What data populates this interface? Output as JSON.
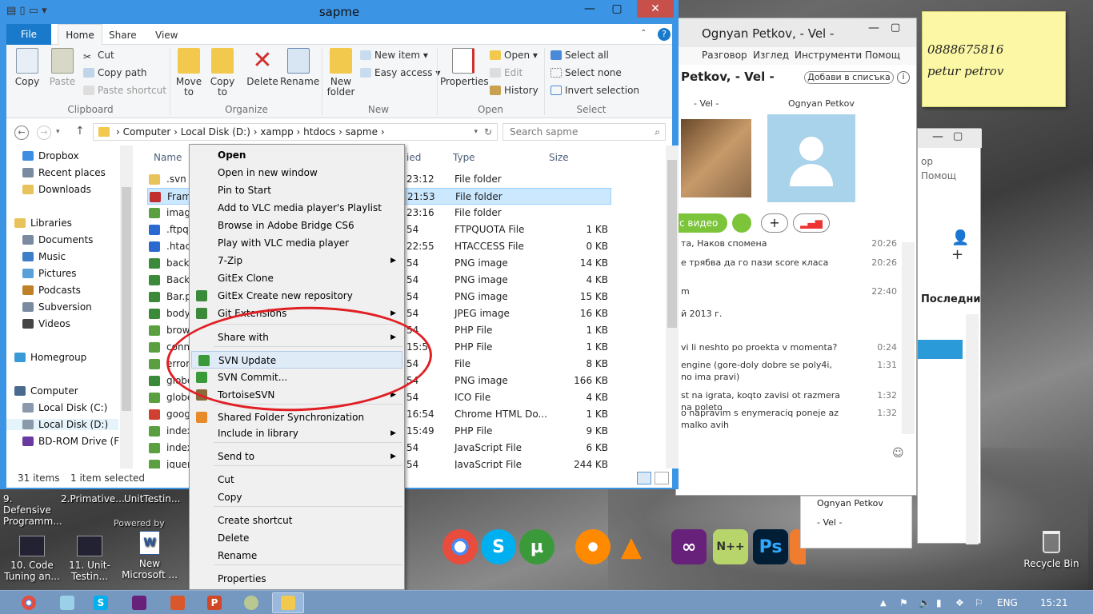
{
  "desktop": {
    "top_labels": [
      "9. Defensive Programm...",
      "2.Primative...",
      "UnitTestin..."
    ],
    "icons": [
      {
        "label": "10. Code Tuning an..."
      },
      {
        "label": "11. Unit-Testin..."
      },
      {
        "label": "New Microsoft ..."
      }
    ],
    "recycle_bin": "Recycle Bin",
    "powered_by": "Powered by"
  },
  "sticky_note": {
    "line1": "0888675816",
    "line2": "petur petrov"
  },
  "explorer": {
    "title": "sapme",
    "tabs": {
      "file": "File",
      "home": "Home",
      "share": "Share",
      "view": "View"
    },
    "ribbon": {
      "copy": "Copy",
      "paste": "Paste",
      "cut": "Cut",
      "copy_path": "Copy path",
      "paste_shortcut": "Paste shortcut",
      "clipboard": "Clipboard",
      "move_to": "Move to",
      "copy_to": "Copy to",
      "delete": "Delete",
      "rename": "Rename",
      "organize": "Organize",
      "new_folder": "New folder",
      "new_item": "New item",
      "easy_access": "Easy access",
      "new": "New",
      "properties": "Properties",
      "open": "Open",
      "edit": "Edit",
      "history": "History",
      "open_group": "Open",
      "select_all": "Select all",
      "select_none": "Select none",
      "invert_selection": "Invert selection",
      "select": "Select"
    },
    "breadcrumb": [
      "Computer",
      "Local Disk (D:)",
      "xampp",
      "htdocs",
      "sapme"
    ],
    "search_placeholder": "Search sapme",
    "nav": [
      {
        "label": "Dropbox",
        "color": "#3d8ee0"
      },
      {
        "label": "Recent places",
        "color": "#7a8aa0"
      },
      {
        "label": "Downloads",
        "color": "#e8c25a"
      },
      {
        "label": "Libraries",
        "color": "#e8c25a"
      },
      {
        "label": "Documents",
        "color": "#7a8aa0"
      },
      {
        "label": "Music",
        "color": "#3d7ec9"
      },
      {
        "label": "Pictures",
        "color": "#5aa0d8"
      },
      {
        "label": "Podcasts",
        "color": "#c0802a"
      },
      {
        "label": "Subversion",
        "color": "#7a8aa0"
      },
      {
        "label": "Videos",
        "color": "#444"
      },
      {
        "label": "Homegroup",
        "color": "#3a9ad8"
      },
      {
        "label": "Computer",
        "color": "#4a6a90"
      },
      {
        "label": "Local Disk (C:)",
        "color": "#8a9aaa"
      },
      {
        "label": "Local Disk (D:)",
        "color": "#8a9aaa"
      },
      {
        "label": "BD-ROM Drive (F",
        "color": "#6a3aa0"
      }
    ],
    "columns": {
      "name": "Name",
      "date": "ied",
      "type": "Type",
      "size": "Size"
    },
    "files": [
      {
        "name": ".svn",
        "date": "23:12",
        "type": "File folder",
        "size": "",
        "color": "#e8c25a"
      },
      {
        "name": "Frame",
        "date": "21:53",
        "type": "File folder",
        "size": "",
        "color": "#c03030"
      },
      {
        "name": "image",
        "date": "23:16",
        "type": "File folder",
        "size": "",
        "color": "#5aa040"
      },
      {
        "name": ".ftpqu",
        "date": "54",
        "type": "FTPQUOTA File",
        "size": "1 KB",
        "color": "#2a6ad0"
      },
      {
        "name": ".htacc",
        "date": "22:55",
        "type": "HTACCESS File",
        "size": "0 KB",
        "color": "#2a6ad0"
      },
      {
        "name": "backg",
        "date": "54",
        "type": "PNG image",
        "size": "14 KB",
        "color": "#3a8a3a"
      },
      {
        "name": "BackL",
        "date": "54",
        "type": "PNG image",
        "size": "4 KB",
        "color": "#3a8a3a"
      },
      {
        "name": "Bar.pr",
        "date": "54",
        "type": "PNG image",
        "size": "15 KB",
        "color": "#3a8a3a"
      },
      {
        "name": "bodyE",
        "date": "54",
        "type": "JPEG image",
        "size": "16 KB",
        "color": "#3a8a3a"
      },
      {
        "name": "brows",
        "date": "54",
        "type": "PHP File",
        "size": "1 KB",
        "color": "#5aa040"
      },
      {
        "name": "conne",
        "date": "15:5",
        "type": "PHP File",
        "size": "1 KB",
        "color": "#5aa040"
      },
      {
        "name": "error_",
        "date": "54",
        "type": "File",
        "size": "8 KB",
        "color": "#5aa040"
      },
      {
        "name": "globe",
        "date": "54",
        "type": "PNG image",
        "size": "166 KB",
        "color": "#3a8a3a"
      },
      {
        "name": "globe",
        "date": "54",
        "type": "ICO File",
        "size": "4 KB",
        "color": "#5aa040"
      },
      {
        "name": "googl",
        "date": "16:54",
        "type": "Chrome HTML Do...",
        "size": "1 KB",
        "color": "#d04030"
      },
      {
        "name": "index.",
        "date": "15:49",
        "type": "PHP File",
        "size": "9 KB",
        "color": "#5aa040"
      },
      {
        "name": "index.",
        "date": "54",
        "type": "JavaScript File",
        "size": "6 KB",
        "color": "#5aa040"
      },
      {
        "name": "jquery",
        "date": "54",
        "type": "JavaScript File",
        "size": "244 KB",
        "color": "#5aa040"
      }
    ],
    "status": {
      "count": "31 items",
      "selected": "1 item selected"
    }
  },
  "context_menu": [
    {
      "label": "Open",
      "bold": true
    },
    {
      "label": "Open in new window"
    },
    {
      "label": "Pin to Start"
    },
    {
      "label": "Add to VLC media player's Playlist"
    },
    {
      "label": "Browse in Adobe Bridge CS6"
    },
    {
      "label": "Play with VLC media player"
    },
    {
      "label": "7-Zip",
      "sub": true
    },
    {
      "label": "GitEx Clone"
    },
    {
      "label": "GitEx Create new repository"
    },
    {
      "label": "Git Extensions",
      "sub": true
    },
    {
      "label": "Share with",
      "sub": true
    },
    {
      "label": "SVN Update"
    },
    {
      "label": "SVN Commit..."
    },
    {
      "label": "TortoiseSVN",
      "sub": true
    },
    {
      "label": "Shared Folder Synchronization"
    },
    {
      "label": "Include in library",
      "sub": true
    },
    {
      "label": "Send to",
      "sub": true
    },
    {
      "label": "Cut"
    },
    {
      "label": "Copy"
    },
    {
      "label": "Create shortcut"
    },
    {
      "label": "Delete"
    },
    {
      "label": "Rename"
    },
    {
      "label": "Properties"
    }
  ],
  "skype": {
    "title": "Ognyan Petkov, - Vel -",
    "menu": [
      "Разговор",
      "Изглед",
      "Инструменти",
      "Помощ"
    ],
    "contact_header": "Petkov, - Vel -",
    "add_to_list": "Добави в списъка",
    "participant1": "- Vel -",
    "participant2": "Ognyan Petkov",
    "video_btn": "с видео",
    "chat": [
      {
        "text": "та, Наков спомена",
        "time": "20:26"
      },
      {
        "text": "е трябва да го пази score класа",
        "time": "20:26"
      },
      {
        "text": "m",
        "time": "22:40"
      },
      {
        "text": "й 2013 г.",
        "time": ""
      },
      {
        "text": "vi li neshto po proekta v momenta?",
        "time": "0:24"
      },
      {
        "text": "engine (gore-doly dobre se poly4i, no ima pravi)",
        "time": "1:31"
      },
      {
        "text": "st na igrata, koqto zavisi ot razmera na poleto",
        "time": "1:32"
      },
      {
        "text": "o napravim s enymeraciq poneje az malko avih",
        "time": "1:32"
      }
    ],
    "side_menu1": "ор",
    "side_menu2": "Помощ",
    "side_latest": "Последни",
    "bottom_contact1": "Ognyan Petkov",
    "bottom_contact2": "- Vel -"
  },
  "taskbar": {
    "lang": "ENG",
    "time": "15:21"
  }
}
